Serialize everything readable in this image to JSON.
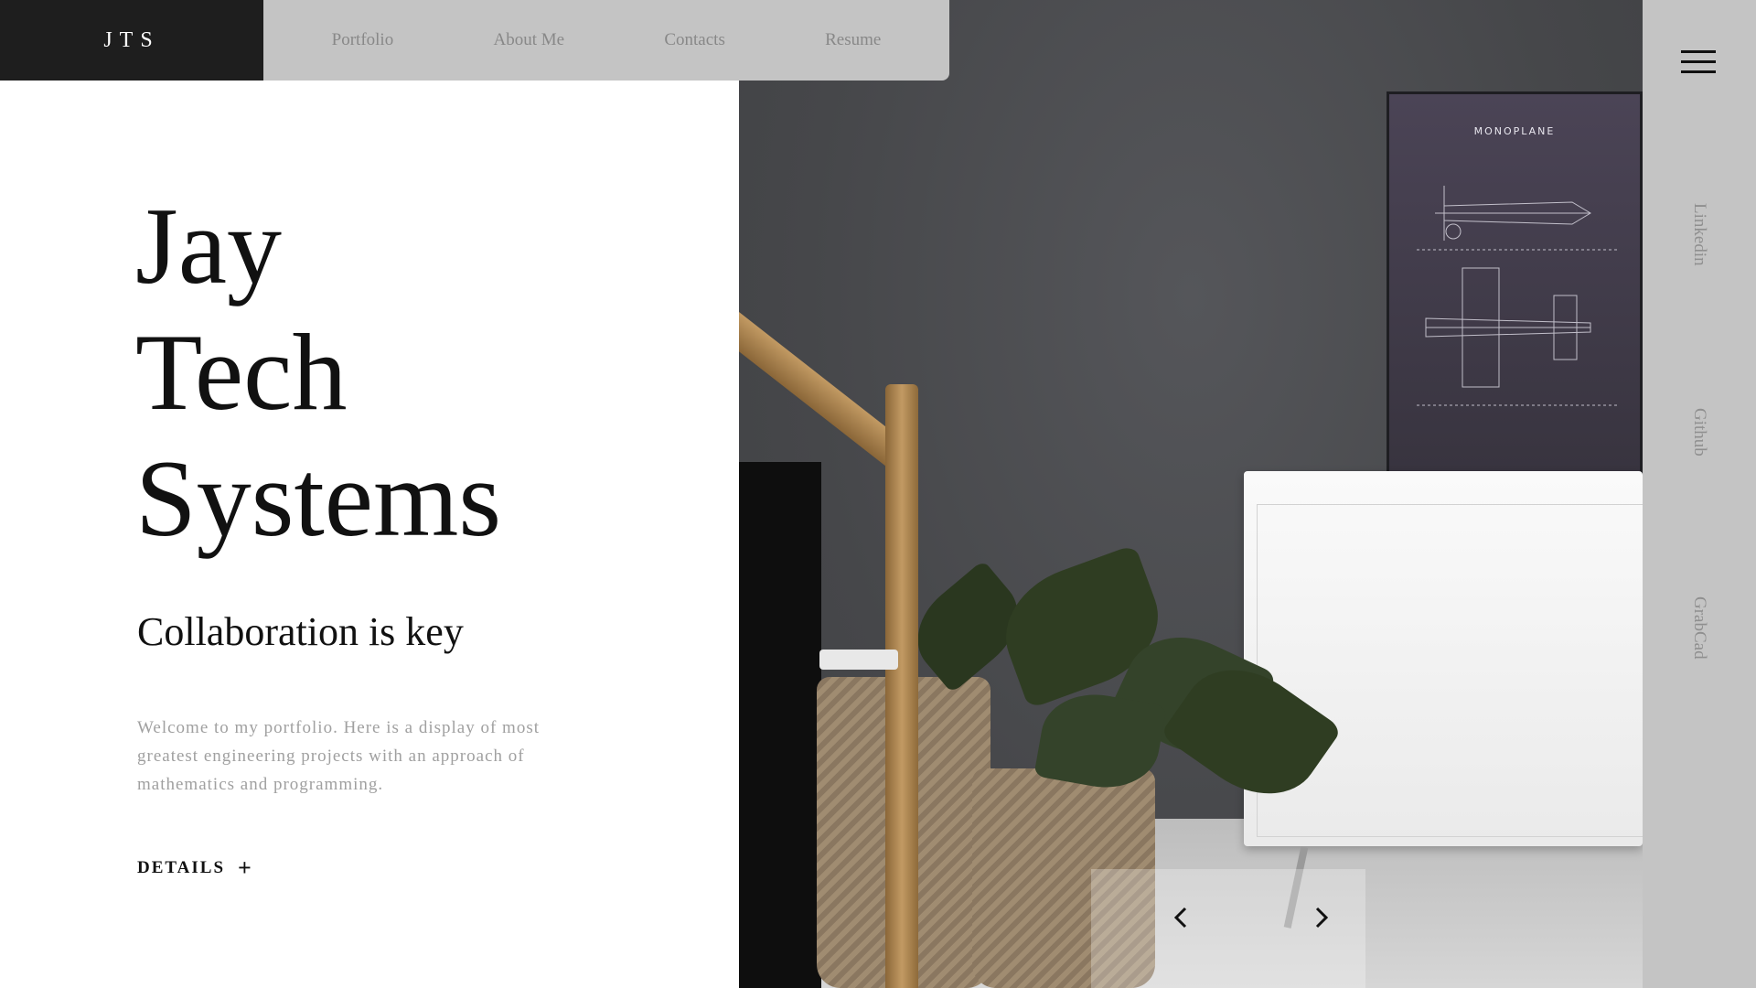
{
  "brand": {
    "logo_text": "JTS"
  },
  "nav": {
    "items": [
      {
        "label": "Portfolio"
      },
      {
        "label": "About Me"
      },
      {
        "label": "Contacts"
      },
      {
        "label": "Resume"
      }
    ]
  },
  "hero": {
    "title_lines": [
      "Jay",
      "Tech",
      "Systems"
    ],
    "tagline": "Collaboration is key",
    "intro": "Welcome to my portfolio. Here is a display of most greatest engineering projects with an approach of mathematics and programming.",
    "details_label": "DETAILS",
    "details_icon": "+"
  },
  "photo": {
    "poster_title": "MONOPLANE",
    "prev_icon": "chevron-left-icon",
    "next_icon": "chevron-right-icon"
  },
  "rail": {
    "menu_icon": "hamburger-menu-icon",
    "social_links": [
      {
        "label": "Linkedin"
      },
      {
        "label": "Github"
      },
      {
        "label": "GrabCad"
      }
    ]
  },
  "colors": {
    "brand_bg": "#1e1e1e",
    "nav_bg": "#c4c4c4",
    "text_dark": "#111111",
    "text_muted": "#a0a0a0",
    "rail_bg": "#c4c4c4"
  }
}
